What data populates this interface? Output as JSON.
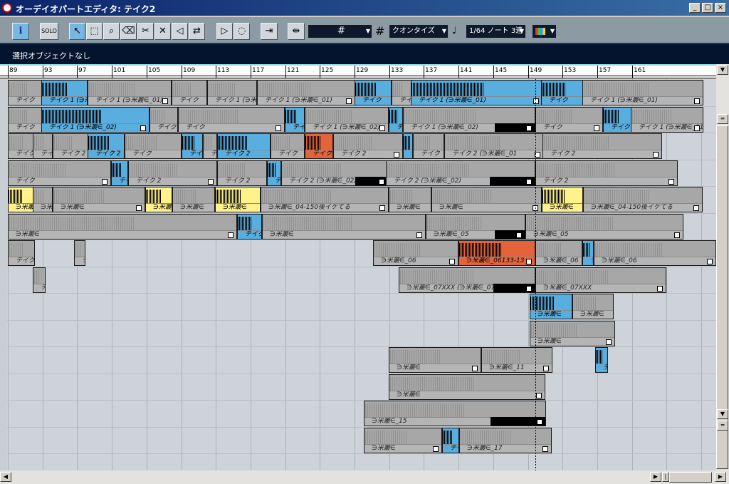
{
  "window": {
    "title": "オーデイオパートエディタ: テイク2",
    "minimize": "_",
    "maximize": "□",
    "close": "×"
  },
  "toolbar": {
    "info_label": "i",
    "solo_label": "SOLO",
    "grid_value": "#",
    "quantize_label": "クオンタイズ",
    "quantize_value": "1/64 ノート 3連"
  },
  "info_line": {
    "text": "選択オブジェクトなし"
  },
  "ruler": {
    "bars": [
      "89",
      "93",
      "97",
      "101",
      "105",
      "109",
      "113",
      "117",
      "121",
      "125",
      "129",
      "133",
      "137",
      "141",
      "145",
      "149",
      "153",
      "157",
      "161"
    ]
  },
  "events": {
    "take1": "テイク 1 (∋米叢∈_01)",
    "take1_02": "テイク 1 (∋米叢∈_02)",
    "take2": "テイク 2",
    "take2_02": "テイク 2 (∋米叢∈_02)",
    "t2_01": "テイク 2 (∋米叢∈_01",
    "r5a": "∋米叢∈_04-150後イケてる",
    "r5b": "∋米叢∈",
    "r6": "∋米叢∈_05",
    "r7": "∋米叢∈_06",
    "r7b": "∋米叢∈_06133-13",
    "r8": "∋米叢∈_07XXX (∋米叢∈_07)",
    "r8b": "∋米叢∈_07XXX",
    "r9": "∋米叢∈",
    "r11": "∋米叢∈_11",
    "r13": "∋米叢∈_15",
    "r14": "∋米叢∈_17",
    "tk": "テイク"
  }
}
